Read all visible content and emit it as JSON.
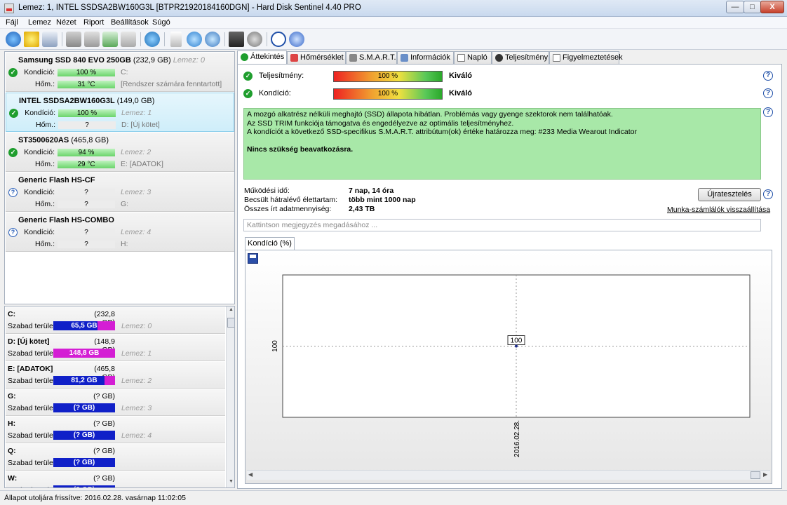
{
  "window": {
    "title": "Lemez: 1, INTEL SSDSA2BW160G3L [BTPR21920184160DGN]  -  Hard Disk Sentinel 4.40 PRO",
    "min": "—",
    "max": "□",
    "close": "X"
  },
  "menu": [
    "Fájl",
    "Lemez",
    "Nézet",
    "Riport",
    "Beállítások",
    "Súgó"
  ],
  "disks": [
    {
      "name": "Samsung SSD 840 EVO 250GB",
      "size": "(232,9 GB)",
      "disk_label": "Lemez: 0",
      "status": "ok",
      "k_label": "Kondíció:",
      "k_value": "100 %",
      "k_pct": 100,
      "k_note": "C:",
      "h_label": "Hőm.:",
      "h_value": "31 °C",
      "h_note": "[Rendszer számára fenntartott]"
    },
    {
      "name": "INTEL SSDSA2BW160G3L",
      "size": "(149,0 GB)",
      "disk_label": "",
      "status": "ok",
      "k_label": "Kondíció:",
      "k_value": "100 %",
      "k_pct": 100,
      "k_note": "Lemez: 1",
      "h_label": "Hőm.:",
      "h_value": "?",
      "h_note": "D: [Új kötet]"
    },
    {
      "name": "ST3500620AS",
      "size": "(465,8 GB)",
      "disk_label": "",
      "status": "ok",
      "k_label": "Kondíció:",
      "k_value": "94 %",
      "k_pct": 94,
      "k_note": "Lemez: 2",
      "h_label": "Hőm.:",
      "h_value": "29 °C",
      "h_note": "E: [ADATOK]"
    },
    {
      "name": "Generic Flash HS-CF",
      "size": "",
      "disk_label": "",
      "status": "unknown",
      "k_label": "Kondíció:",
      "k_value": "?",
      "k_pct": 0,
      "k_note": "Lemez: 3",
      "h_label": "Hőm.:",
      "h_value": "?",
      "h_note": "G:"
    },
    {
      "name": "Generic Flash HS-COMBO",
      "size": "",
      "disk_label": "",
      "status": "unknown",
      "k_label": "Kondíció:",
      "k_value": "?",
      "k_pct": 0,
      "k_note": "Lemez: 4",
      "h_label": "Hőm.:",
      "h_value": "?",
      "h_note": "H:"
    }
  ],
  "volumes": [
    {
      "name": "C:",
      "size": "(232,8 GB)",
      "label": "Szabad terület",
      "free": "65,5 GB",
      "used_fraction": 0.28,
      "note": "Lemez: 0"
    },
    {
      "name": "D: [Új kötet]",
      "size": "(148,9 GB)",
      "label": "Szabad terület",
      "free": "148,8 GB",
      "used_fraction": 1.0,
      "note": "Lemez: 1"
    },
    {
      "name": "E: [ADATOK]",
      "size": "(465,8 GB)",
      "label": "Szabad terület",
      "free": "81,2 GB",
      "used_fraction": 0.17,
      "note": "Lemez: 2"
    },
    {
      "name": "G:",
      "size": "(? GB)",
      "label": "Szabad terület",
      "free": "(? GB)",
      "used_fraction": 0,
      "note": "Lemez: 3"
    },
    {
      "name": "H:",
      "size": "(? GB)",
      "label": "Szabad terület",
      "free": "(? GB)",
      "used_fraction": 0,
      "note": "Lemez: 4"
    },
    {
      "name": "Q:",
      "size": "(? GB)",
      "label": "Szabad terület",
      "free": "(? GB)",
      "used_fraction": 0,
      "note": ""
    },
    {
      "name": "W:",
      "size": "(? GB)",
      "label": "Szabad terület",
      "free": "(? GB)",
      "used_fraction": 0,
      "note": ""
    }
  ],
  "tabs": [
    "Áttekintés",
    "Hőmérséklet",
    "S.M.A.R.T.",
    "Információk",
    "Napló",
    "Teljesítmény",
    "Figyelmeztetések"
  ],
  "overview": {
    "perf_label": "Teljesítmény:",
    "perf_value": "100 %",
    "perf_rating": "Kiváló",
    "cond_label": "Kondíció:",
    "cond_value": "100 %",
    "cond_rating": "Kiváló",
    "info_lines": [
      "A mozgó alkatrész nélküli meghajtó (SSD) állapota hibátlan. Problémás vagy gyenge szektorok nem találhatóak.",
      "Az SSD TRIM funkciója támogatva és engedélyezve az optimális teljesítményhez.",
      "A kondíciót a következő SSD-specifikus S.M.A.R.T. attribútum(ok) értéke határozza meg:  #233 Media Wearout Indicator"
    ],
    "info_bold": "Nincs szükség beavatkozásra.",
    "uptime_label": "Működési idő:",
    "uptime_value": "7 nap, 14 óra",
    "remaining_label": "Becsült hátralévő élettartam:",
    "remaining_value": "több mint 1000 nap",
    "written_label": "Összes írt adatmennyiség:",
    "written_value": "2,43 TB",
    "retest_button": "Újratesztelés",
    "reset_link": "Munka-számlálók visszaállítása",
    "note_placeholder": "Kattintson megjegyzés megadásához ..."
  },
  "chart_tab": "Kondíció  (%)",
  "chart_data": {
    "type": "line",
    "x": [
      "2016.02.28."
    ],
    "series": [
      {
        "values": [
          100
        ]
      }
    ],
    "yticks": [
      "100"
    ],
    "xticks": [
      "2016.02.28."
    ],
    "data_labels": [
      "100"
    ],
    "grid": true
  },
  "status": "Állapot utoljára frissítve: 2016.02.28. vasárnap 11:02:05",
  "colors": {
    "ok": "#1f9e2e",
    "free_bar": "#1020c8",
    "used_bar": "#d41ed4",
    "info_bg": "#a8e8a8"
  }
}
